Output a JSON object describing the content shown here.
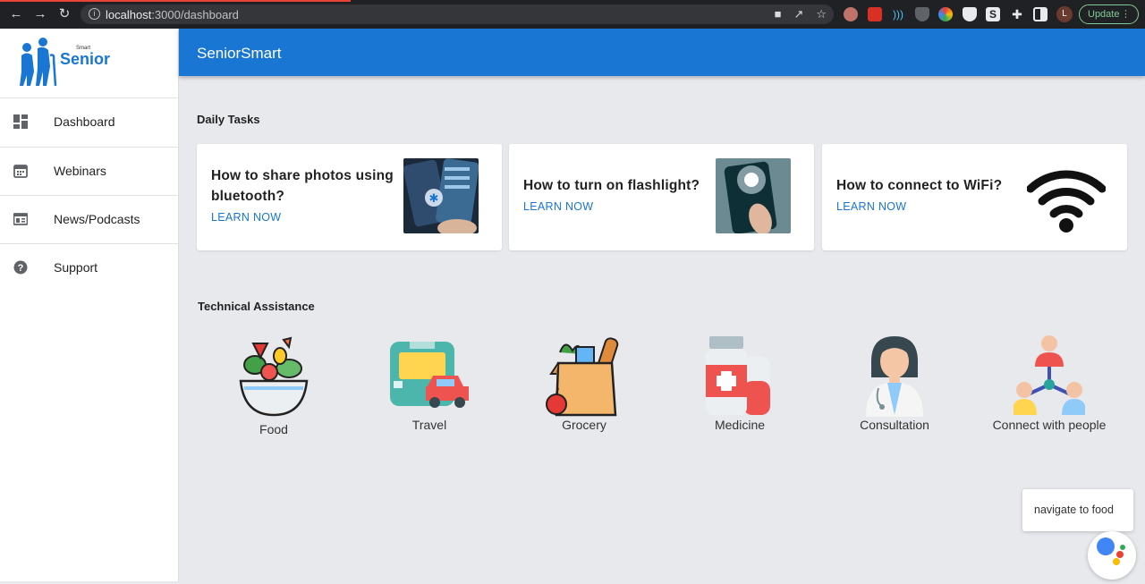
{
  "browser": {
    "url_host": "localhost",
    "url_path": ":3000/dashboard",
    "update_label": "Update",
    "profile_initial": "L"
  },
  "sidebar": {
    "logo_small": "Smart",
    "logo_text": "Senior",
    "items": [
      {
        "label": "Dashboard",
        "icon": "dashboard-icon"
      },
      {
        "label": "Webinars",
        "icon": "calendar-icon"
      },
      {
        "label": "News/Podcasts",
        "icon": "news-icon"
      },
      {
        "label": "Support",
        "icon": "help-icon"
      }
    ]
  },
  "appbar": {
    "title": "SeniorSmart"
  },
  "daily_tasks": {
    "title": "Daily Tasks",
    "cards": [
      {
        "title": "How to share photos using bluetooth?",
        "action": "LEARN NOW",
        "image": "bluetooth-phone-photo"
      },
      {
        "title": "How to turn on flashlight?",
        "action": "LEARN NOW",
        "image": "flashlight-phone-photo"
      },
      {
        "title": "How to connect to WiFi?",
        "action": "LEARN NOW",
        "image": "wifi-icon"
      }
    ]
  },
  "technical_assistance": {
    "title": "Technical Assistance",
    "tiles": [
      {
        "label": "Food",
        "icon": "salad-bowl-icon"
      },
      {
        "label": "Travel",
        "icon": "bus-car-icon"
      },
      {
        "label": "Grocery",
        "icon": "grocery-bag-icon"
      },
      {
        "label": "Medicine",
        "icon": "medicine-bottle-icon"
      },
      {
        "label": "Consultation",
        "icon": "doctor-icon"
      },
      {
        "label": "Connect with people",
        "icon": "people-network-icon"
      }
    ]
  },
  "assistant": {
    "toast": "navigate to food"
  },
  "colors": {
    "primary": "#1976d2",
    "background": "#e8e9ed"
  }
}
